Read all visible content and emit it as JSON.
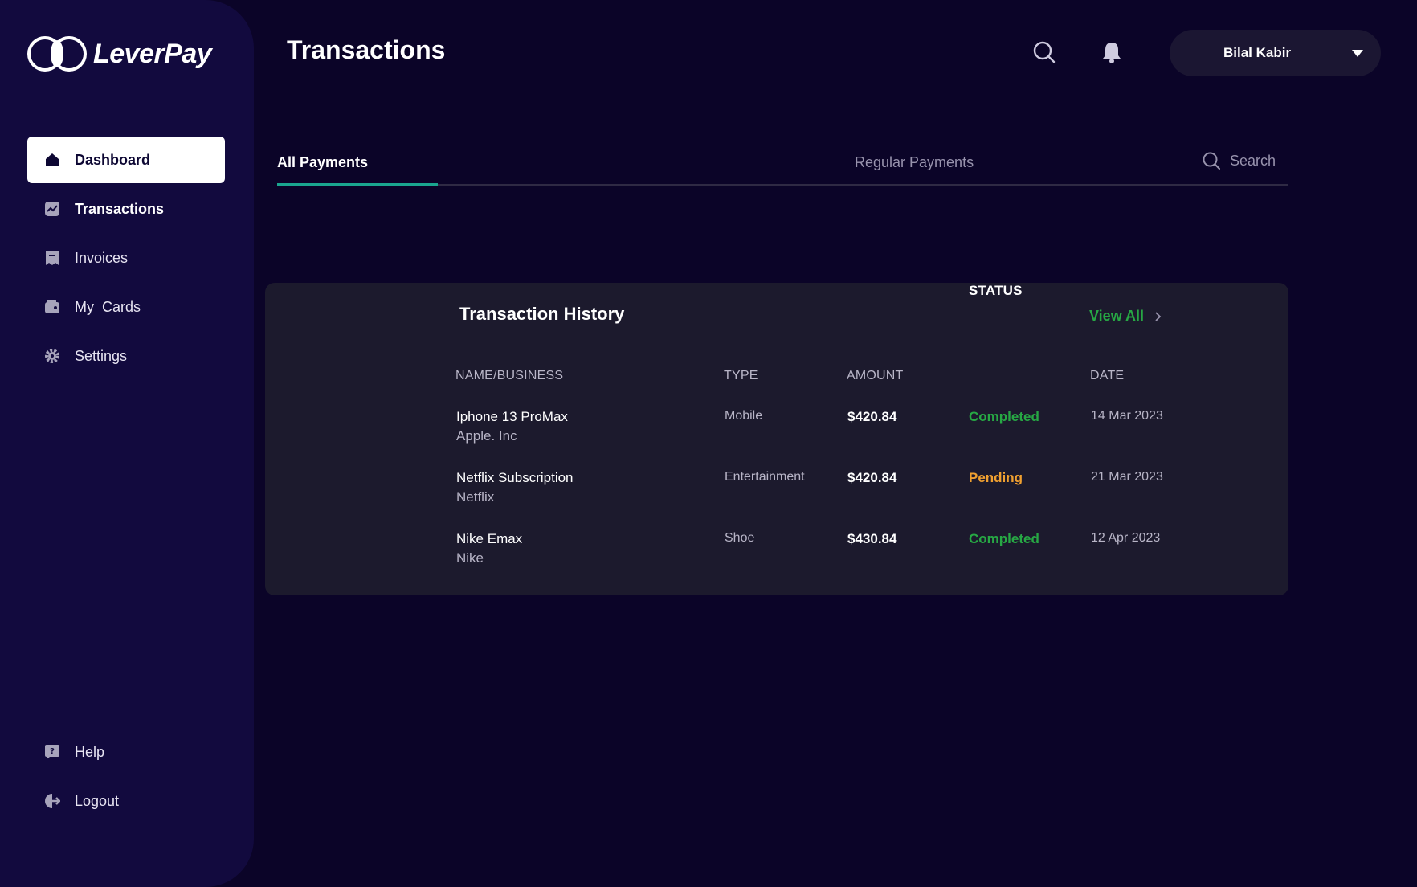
{
  "app": {
    "name": "LeverPay"
  },
  "colors": {
    "accent_green": "#27a844",
    "tab_underline": "#1aa68f",
    "pending": "#f0a030",
    "background": "#0b0428",
    "sidebar": "#120a3e",
    "card": "#1c1a2d"
  },
  "sidebar": {
    "items": [
      {
        "label": "Dashboard",
        "icon": "home-icon"
      },
      {
        "label": "Transactions",
        "icon": "chart-icon"
      },
      {
        "label": "Invoices",
        "icon": "invoice-icon"
      },
      {
        "label": "My  Cards",
        "icon": "wallet-icon"
      },
      {
        "label": "Settings",
        "icon": "gear-icon"
      }
    ],
    "bottom": [
      {
        "label": "Help",
        "icon": "help-icon"
      },
      {
        "label": "Logout",
        "icon": "logout-icon"
      }
    ]
  },
  "header": {
    "title": "Transactions",
    "user": {
      "name": "Bilal Kabir"
    }
  },
  "tabs": {
    "all": "All Payments",
    "regular": "Regular Payments",
    "search_placeholder": "Search"
  },
  "history": {
    "title": "Transaction History",
    "view_all": "View All",
    "columns": [
      "NAME/BUSINESS",
      "TYPE",
      "AMOUNT",
      "STATUS",
      "DATE"
    ],
    "rows": [
      {
        "name": "Iphone 13 ProMax",
        "business": "Apple. Inc",
        "type": "Mobile",
        "amount": "$420.84",
        "status": "Completed",
        "date": "14 Mar 2023"
      },
      {
        "name": "Netflix Subscription",
        "business": "Netflix",
        "type": "Entertainment",
        "amount": "$420.84",
        "status": "Pending",
        "date": "21 Mar 2023"
      },
      {
        "name": "Nike Emax",
        "business": "Nike",
        "type": "Shoe",
        "amount": "$430.84",
        "status": "Completed",
        "date": "12 Apr 2023"
      }
    ]
  }
}
